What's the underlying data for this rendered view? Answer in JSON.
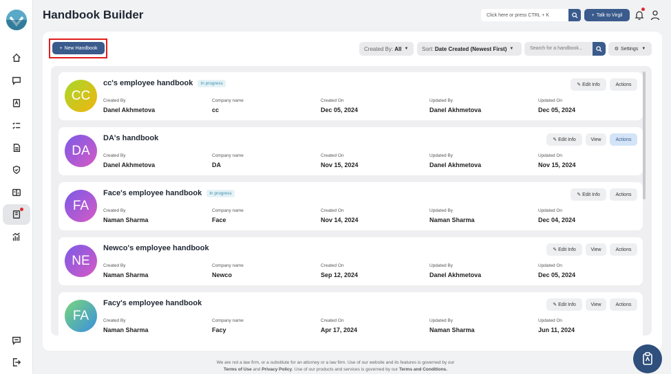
{
  "app": {
    "title": "Handbook Builder"
  },
  "topbar": {
    "search_placeholder": "Click here or press CTRL + K",
    "virgil_label": "Talk to Virgil",
    "plus_glyph": "+"
  },
  "toolbar": {
    "new_label": "New Handbook",
    "created_by_label": "Created By:",
    "created_by_value": "All",
    "sort_label": "Sort:",
    "sort_value": "Date Created (Newest First)",
    "search_placeholder": "Search for a handbook...",
    "settings_label": "Settings"
  },
  "columns": {
    "created_by": "Created By",
    "company": "Company name",
    "created_on": "Created On",
    "updated_by": "Updated By",
    "updated_on": "Updated On"
  },
  "buttons": {
    "edit": "Edit Info",
    "view": "View",
    "actions": "Actions"
  },
  "handbooks": [
    {
      "initials": "CC",
      "name": "cc's employee handbook",
      "status": "In progress",
      "created_by": "Danel Akhmetova",
      "company": "cc",
      "created_on": "Dec 05, 2024",
      "updated_by": "Danel Akhmetova",
      "updated_on": "Dec 05, 2024",
      "gradient": [
        "#a8d82a",
        "#f0b410"
      ]
    },
    {
      "initials": "DA",
      "name": "DA's handbook",
      "status": "",
      "created_by": "Danel Akhmetova",
      "company": "DA",
      "created_on": "Nov 15, 2024",
      "updated_by": "Danel Akhmetova",
      "updated_on": "Nov 15, 2024",
      "gradient": [
        "#7a5ae8",
        "#d65ac4"
      ]
    },
    {
      "initials": "FA",
      "name": "Face's employee handbook",
      "status": "In progress",
      "created_by": "Naman Sharma",
      "company": "Face",
      "created_on": "Nov 14, 2024",
      "updated_by": "Naman Sharma",
      "updated_on": "Dec 04, 2024",
      "gradient": [
        "#7a5ae8",
        "#d65ac4"
      ]
    },
    {
      "initials": "NE",
      "name": "Newco's employee handbook",
      "status": "",
      "created_by": "Naman Sharma",
      "company": "Newco",
      "created_on": "Sep 12, 2024",
      "updated_by": "Danel Akhmetova",
      "updated_on": "Dec 05, 2024",
      "gradient": [
        "#7a5ae8",
        "#d65ac4"
      ]
    },
    {
      "initials": "FA",
      "name": "Facy's employee handbook",
      "status": "",
      "created_by": "Naman Sharma",
      "company": "Facy",
      "created_on": "Apr 17, 2024",
      "updated_by": "Naman Sharma",
      "updated_on": "Jun 11, 2024",
      "gradient": [
        "#7ad67a",
        "#3a8fe0"
      ]
    }
  ],
  "footer": {
    "line1": "We are not a law firm, or a substitute for an attorney or a law firm. Use of our website and its features is governed by our",
    "terms": "Terms of Use",
    "and": "and",
    "privacy": "Privacy Policy",
    "line2_mid": ". Use of our products and services is governed by our",
    "terms_conditions": "Terms and Conditions."
  },
  "colors": {
    "accent": "#3a5b8c",
    "badge_text": "#3c8fb0",
    "highlight": "#e21b1b"
  }
}
